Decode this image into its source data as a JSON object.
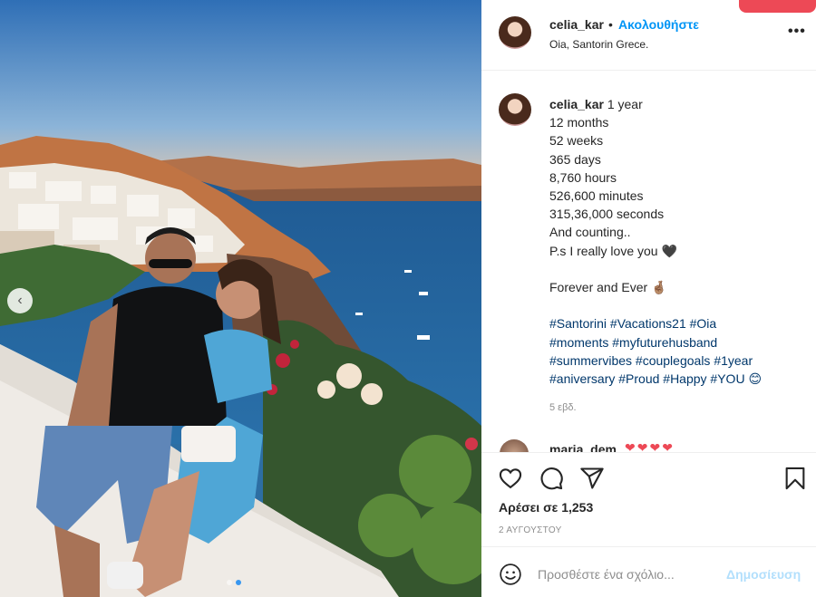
{
  "post": {
    "username": "celia_kar",
    "follow_separator": "•",
    "follow_label": "Ακολουθήστε",
    "location": "Oia, Santorin Grece.",
    "more_label": "•••"
  },
  "caption": {
    "username": "celia_kar",
    "first_line_rest": " 1 year",
    "lines": [
      "12 months",
      "52 weeks",
      "365 days",
      "8,760 hours",
      "526,600 minutes",
      "315,36,000 seconds",
      "And counting..",
      "P.s I really love you 🖤",
      "",
      "Forever and Ever 🤞🏽",
      ""
    ],
    "hashtag_lines": [
      "#Santorini #Vacations21 #Oia",
      "#moments #myfuturehusband",
      "#summervibes #couplegoals #1year",
      "#aniversary #Proud #Happy #YOU 😊"
    ],
    "time_ago": "5 εβδ."
  },
  "comment_preview": {
    "username": "maria_dem",
    "hearts": "❤❤❤❤"
  },
  "actions": {
    "likes": "Αρέσει σε 1,253",
    "date": "2 ΑΥΓΟΥΣΤΟΥ",
    "icons": [
      "heart-icon",
      "comment-icon",
      "share-icon",
      "bookmark-icon"
    ]
  },
  "comment_box": {
    "placeholder": "Προσθέστε ένα σχόλιο...",
    "post_label": "Δημοσίευση"
  },
  "carousel": {
    "prev_label": "‹"
  },
  "colors": {
    "link_blue": "#0095f6",
    "hashtag": "#00376b",
    "like_red": "#ed4956",
    "muted": "#8e8e8e"
  }
}
